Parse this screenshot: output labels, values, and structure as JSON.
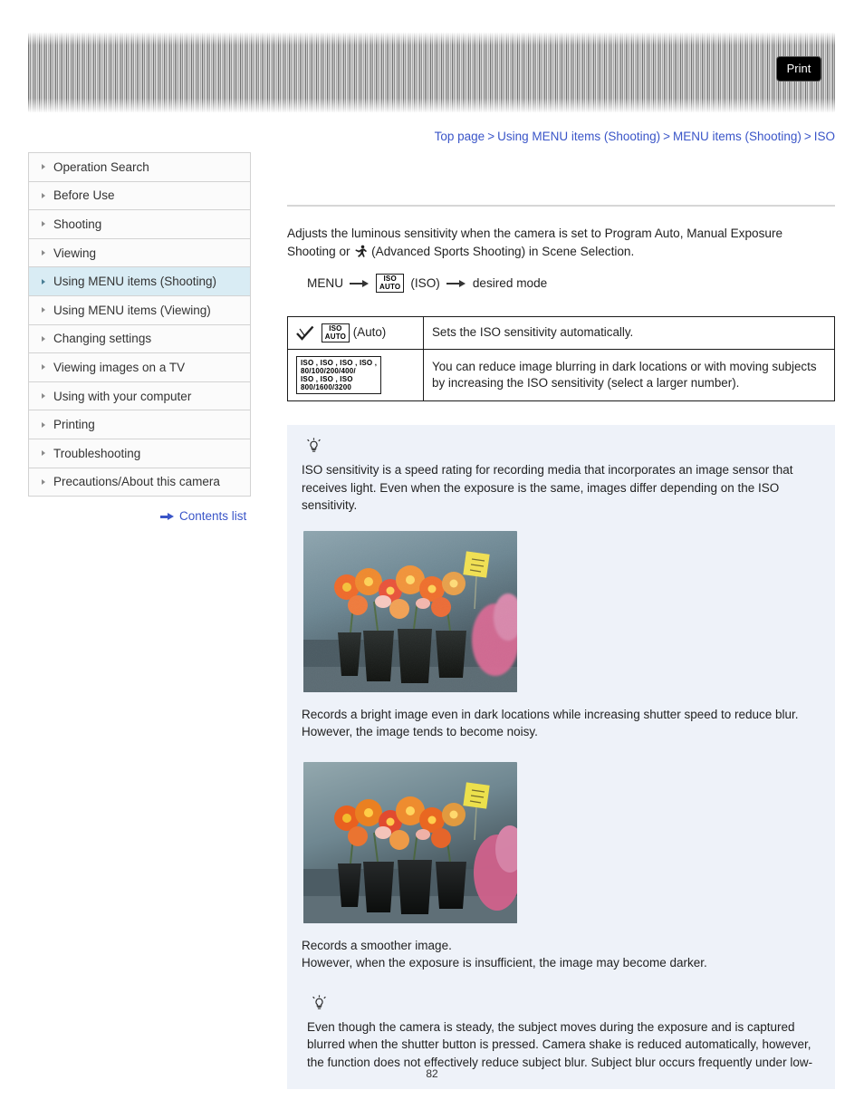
{
  "toolbar": {
    "print_label": "Print"
  },
  "breadcrumb": {
    "items": [
      "Top page",
      "Using MENU items (Shooting)",
      "MENU items (Shooting)",
      "ISO"
    ],
    "separator": ">"
  },
  "sidebar": {
    "items": [
      {
        "label": "Operation Search",
        "active": false
      },
      {
        "label": "Before Use",
        "active": false
      },
      {
        "label": "Shooting",
        "active": false
      },
      {
        "label": "Viewing",
        "active": false
      },
      {
        "label": "Using MENU items (Shooting)",
        "active": true
      },
      {
        "label": "Using MENU items (Viewing)",
        "active": false
      },
      {
        "label": "Changing settings",
        "active": false
      },
      {
        "label": "Viewing images on a TV",
        "active": false
      },
      {
        "label": "Using with your computer",
        "active": false
      },
      {
        "label": "Printing",
        "active": false
      },
      {
        "label": "Troubleshooting",
        "active": false
      },
      {
        "label": "Precautions/About this camera",
        "active": false
      }
    ],
    "contents_link": "Contents list"
  },
  "main": {
    "intro_line1": "Adjusts the luminous sensitivity when the camera is set to Program Auto, Manual Exposure",
    "intro_line2_before": "Shooting or",
    "intro_line2_after": "(Advanced Sports Shooting) in Scene Selection.",
    "menu_path": {
      "menu_label": "MENU",
      "iso_top": "ISO",
      "iso_bottom": "AUTO",
      "iso_paren": "(ISO)",
      "desired": "desired mode"
    },
    "table": {
      "rows": [
        {
          "icon_top": "ISO",
          "icon_bottom": "AUTO",
          "icon_label": "(Auto)",
          "description": "Sets the ISO sensitivity automatically."
        },
        {
          "values_line1": "ISO , ISO , ISO , ISO ,",
          "values_line2": "80/100/200/400/",
          "values_line3": "ISO  ,  ISO  ,  ISO",
          "values_line4": "800/1600/3200",
          "description_line1": "You can reduce image blurring in dark locations or with moving subjects",
          "description_line2": "by increasing the ISO sensitivity (select a larger number)."
        }
      ]
    },
    "tip": {
      "text_line1": "ISO sensitivity is a speed rating for recording media that incorporates an image sensor that",
      "text_line2": "receives light. Even when the exposure is the same, images differ depending on the ISO",
      "text_line3": "sensitivity.",
      "photo1_caption_line1": "Records a bright image even in dark locations while increasing shutter speed to reduce blur.",
      "photo1_caption_line2": "However, the image tends to become noisy.",
      "photo2_caption_line1": "Records a smoother image.",
      "photo2_caption_line2": "However, when the exposure is insufficient, the image may become darker.",
      "inner_line1": "Even though the camera is steady, the subject moves during the exposure and is captured",
      "inner_line2": "blurred when the shutter button is pressed. Camera shake is reduced automatically, however,",
      "inner_line3": "the function does not effectively reduce subject blur. Subject blur occurs frequently under low-"
    }
  },
  "footer": {
    "page_number": "82"
  },
  "colors": {
    "link": "#3a55c8",
    "sidebar_active": "#d9ecf4",
    "tip_background": "#eef2f9"
  }
}
